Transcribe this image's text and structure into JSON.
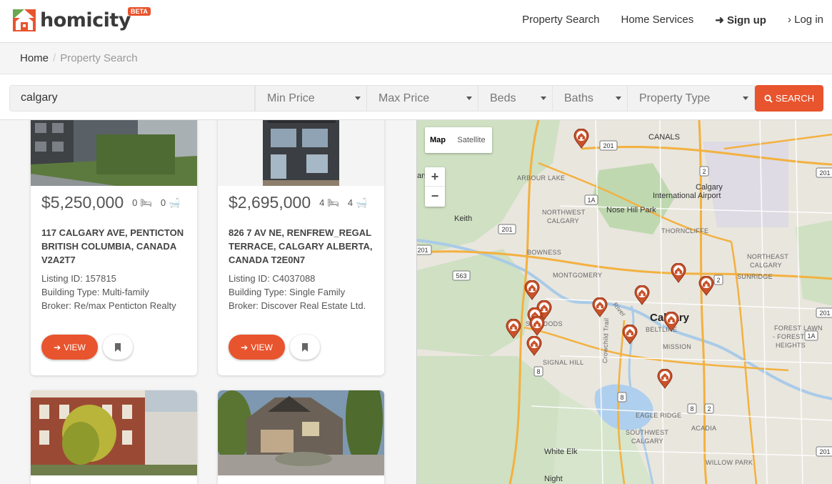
{
  "brand": {
    "name": "homicity",
    "badge": "BETA"
  },
  "nav": {
    "property_search": "Property Search",
    "home_services": "Home Services",
    "sign_up": "Sign up",
    "log_in": "Log in"
  },
  "breadcrumb": {
    "home": "Home",
    "separator": "/",
    "current": "Property Search"
  },
  "search": {
    "query": "calgary",
    "min_price": "Min Price",
    "max_price": "Max Price",
    "beds": "Beds",
    "baths": "Baths",
    "property_type": "Property Type",
    "button": "SEARCH"
  },
  "listings": [
    {
      "price": "$5,250,000",
      "beds": "0",
      "baths": "0",
      "address": "117 CALGARY AVE, PENTICTON BRITISH COLUMBIA, CANADA V2A2T7",
      "listing_id": "Listing ID: 157815",
      "building_type": "Building Type: Multi-family",
      "broker": "Broker: Re/max Penticton Realty",
      "view_label": "VIEW"
    },
    {
      "price": "$2,695,000",
      "beds": "4",
      "baths": "4",
      "address": "826 7 AV NE, RENFREW_REGAL TERRACE, CALGARY ALBERTA, CANADA T2E0N7",
      "listing_id": "Listing ID: C4037088",
      "building_type": "Building Type: Single Family",
      "broker": "Broker: Discover Real Estate Ltd.",
      "view_label": "VIEW"
    }
  ],
  "map": {
    "type_map": "Map",
    "type_satellite": "Satellite",
    "zoom_in": "+",
    "zoom_out": "−",
    "labels": {
      "calgary": "Calgary",
      "canals": "CANALS",
      "arbour_lake": "ARBOUR LAKE",
      "airport_a": "Calgary",
      "airport_b": "International Airport",
      "keith": "Keith",
      "nose_hill": "Nose Hill Park",
      "thorncliffe": "THORNCLIFFE",
      "nw_calgary_a": "NORTHWEST",
      "nw_calgary_b": "CALGARY",
      "bowness": "BOWNESS",
      "montgomery": "MONTGOMERY",
      "ne_calgary_a": "NORTHEAST",
      "ne_calgary_b": "CALGARY",
      "sunridge": "SUNRIDGE",
      "river": "River",
      "beltline": "BELTLINE",
      "spruce_woods": "SP  WOODS",
      "mission": "MISSION",
      "forest_lawn_a": "FOREST LAWN",
      "forest_lawn_b": "- FOREST",
      "forest_lawn_c": "HEIGHTS",
      "signal_hill": "SIGNAL HILL",
      "crowchild": "Crowchild Trail",
      "eagle_ridge": "EAGLE RIDGE",
      "sw_calgary_a": "SOUTHWEST",
      "sw_calgary_b": "CALGARY",
      "acadia": "ACADIA",
      "white_elk": "White Elk",
      "willow_park": "WILLOW PARK",
      "night": "Night",
      "ars": "ars"
    },
    "shields": [
      "201",
      "2",
      "201",
      "1A",
      "201",
      "563",
      "2",
      "1A",
      "8",
      "8",
      "8",
      "2",
      "201",
      "201",
      "201"
    ]
  }
}
